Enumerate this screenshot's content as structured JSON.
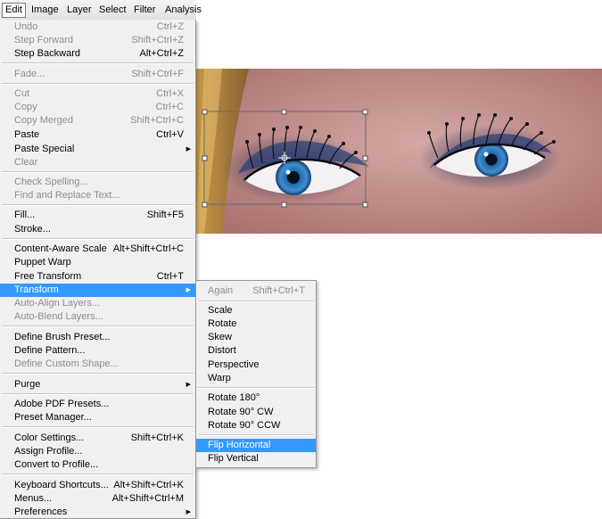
{
  "menubar": {
    "items": [
      {
        "label": "Edit",
        "active": true
      },
      {
        "label": "Image"
      },
      {
        "label": "Layer"
      },
      {
        "label": "Select"
      },
      {
        "label": "Filter"
      },
      {
        "label": "Analysis"
      }
    ]
  },
  "edit_menu": {
    "items": [
      {
        "label": "Undo",
        "shortcut": "Ctrl+Z",
        "disabled": true
      },
      {
        "label": "Step Forward",
        "shortcut": "Shift+Ctrl+Z",
        "disabled": true
      },
      {
        "label": "Step Backward",
        "shortcut": "Alt+Ctrl+Z"
      },
      {
        "label": "Fade...",
        "shortcut": "Shift+Ctrl+F",
        "disabled": true
      },
      {
        "label": "Cut",
        "shortcut": "Ctrl+X",
        "disabled": true
      },
      {
        "label": "Copy",
        "shortcut": "Ctrl+C",
        "disabled": true
      },
      {
        "label": "Copy Merged",
        "shortcut": "Shift+Ctrl+C",
        "disabled": true
      },
      {
        "label": "Paste",
        "shortcut": "Ctrl+V"
      },
      {
        "label": "Paste Special",
        "submenu": true
      },
      {
        "label": "Clear",
        "disabled": true
      },
      {
        "label": "Check Spelling...",
        "disabled": true
      },
      {
        "label": "Find and Replace Text...",
        "disabled": true
      },
      {
        "label": "Fill...",
        "shortcut": "Shift+F5"
      },
      {
        "label": "Stroke..."
      },
      {
        "label": "Content-Aware Scale",
        "shortcut": "Alt+Shift+Ctrl+C"
      },
      {
        "label": "Puppet Warp"
      },
      {
        "label": "Free Transform",
        "shortcut": "Ctrl+T"
      },
      {
        "label": "Transform",
        "submenu": true,
        "highlighted": true
      },
      {
        "label": "Auto-Align Layers...",
        "disabled": true
      },
      {
        "label": "Auto-Blend Layers...",
        "disabled": true
      },
      {
        "label": "Define Brush Preset..."
      },
      {
        "label": "Define Pattern..."
      },
      {
        "label": "Define Custom Shape...",
        "disabled": true
      },
      {
        "label": "Purge",
        "submenu": true
      },
      {
        "label": "Adobe PDF Presets..."
      },
      {
        "label": "Preset Manager..."
      },
      {
        "label": "Color Settings...",
        "shortcut": "Shift+Ctrl+K"
      },
      {
        "label": "Assign Profile..."
      },
      {
        "label": "Convert to Profile..."
      },
      {
        "label": "Keyboard Shortcuts...",
        "shortcut": "Alt+Shift+Ctrl+K"
      },
      {
        "label": "Menus...",
        "shortcut": "Alt+Shift+Ctrl+M"
      },
      {
        "label": "Preferences",
        "submenu": true
      }
    ]
  },
  "transform_submenu": {
    "items": [
      {
        "label": "Again",
        "shortcut": "Shift+Ctrl+T",
        "disabled": true
      },
      {
        "label": "Scale"
      },
      {
        "label": "Rotate"
      },
      {
        "label": "Skew"
      },
      {
        "label": "Distort"
      },
      {
        "label": "Perspective"
      },
      {
        "label": "Warp"
      },
      {
        "label": "Rotate 180°"
      },
      {
        "label": "Rotate 90° CW"
      },
      {
        "label": "Rotate 90° CCW"
      },
      {
        "label": "Flip Horizontal",
        "highlighted": true
      },
      {
        "label": "Flip Vertical"
      }
    ]
  },
  "colors": {
    "highlight": "#3399ff",
    "menu_bg": "#f0f0f0",
    "disabled_text": "#8c8c8c"
  }
}
